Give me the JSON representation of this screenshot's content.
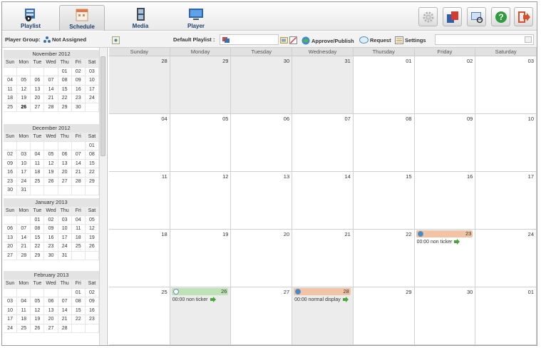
{
  "nav": {
    "playlist": "Playlist",
    "schedule": "Schedule",
    "media": "Media",
    "player": "Player"
  },
  "right_icons": [
    "settings-gear-icon",
    "publish-stack-icon",
    "monitor-search-icon",
    "help-icon",
    "logout-icon"
  ],
  "toolbar": {
    "player_group_label": "Player Group:",
    "player_group_value": "Not Assigned",
    "default_playlist_label": "Default Playlist :",
    "approve_publish": "Approve/Publish",
    "request": "Request",
    "settings": "Settings",
    "search_placeholder": ""
  },
  "mini_calendars": [
    {
      "title": "November 2012",
      "days": [
        "",
        "",
        "",
        "",
        "01",
        "02",
        "03",
        "04",
        "05",
        "06",
        "07",
        "08",
        "09",
        "10",
        "11",
        "12",
        "13",
        "14",
        "15",
        "16",
        "17",
        "18",
        "19",
        "20",
        "21",
        "22",
        "23",
        "24",
        "25",
        "26",
        "27",
        "28",
        "29",
        "30",
        ""
      ],
      "today": "26"
    },
    {
      "title": "December 2012",
      "days": [
        "",
        "",
        "",
        "",
        "",
        "",
        "01",
        "02",
        "03",
        "04",
        "05",
        "06",
        "07",
        "08",
        "09",
        "10",
        "11",
        "12",
        "13",
        "14",
        "15",
        "16",
        "17",
        "18",
        "19",
        "20",
        "21",
        "22",
        "23",
        "24",
        "25",
        "26",
        "27",
        "28",
        "29",
        "30",
        "31",
        "",
        "",
        "",
        "",
        ""
      ]
    },
    {
      "title": "January 2013",
      "days": [
        "",
        "",
        "01",
        "02",
        "03",
        "04",
        "05",
        "06",
        "07",
        "08",
        "09",
        "10",
        "11",
        "12",
        "13",
        "14",
        "15",
        "16",
        "17",
        "18",
        "19",
        "20",
        "21",
        "22",
        "23",
        "24",
        "25",
        "26",
        "27",
        "28",
        "29",
        "30",
        "31",
        "",
        ""
      ]
    },
    {
      "title": "February 2013",
      "days": [
        "",
        "",
        "",
        "",
        "",
        "01",
        "02",
        "03",
        "04",
        "05",
        "06",
        "07",
        "08",
        "09",
        "10",
        "11",
        "12",
        "13",
        "14",
        "15",
        "16",
        "17",
        "18",
        "19",
        "20",
        "21",
        "22",
        "23",
        "24",
        "25",
        "26",
        "27",
        "28",
        "",
        ""
      ]
    }
  ],
  "weekdays_short": [
    "Sun",
    "Mon",
    "Tue",
    "Wed",
    "Thu",
    "Fri",
    "Sat"
  ],
  "weekdays": [
    "Sunday",
    "Monday",
    "Tuesday",
    "Wednesday",
    "Thursday",
    "Friday",
    "Saturday"
  ],
  "calendar_days": [
    "28",
    "29",
    "30",
    "31",
    "01",
    "02",
    "03",
    "04",
    "05",
    "06",
    "07",
    "08",
    "09",
    "10",
    "11",
    "12",
    "13",
    "14",
    "15",
    "16",
    "17",
    "18",
    "19",
    "20",
    "21",
    "22",
    "23",
    "24",
    "25",
    "26",
    "27",
    "28",
    "29",
    "30",
    "01"
  ],
  "events": [
    {
      "cell": 26,
      "color": "orange",
      "text": "00:00 non ticker"
    },
    {
      "cell": 29,
      "color": "green",
      "text": "00:00 non ticker"
    },
    {
      "cell": 31,
      "color": "orange",
      "text": "00:00 normal display"
    }
  ],
  "colors": {
    "event_green": "#bfe2b7",
    "event_orange": "#f3c3a5",
    "nav_text": "#1f3f6c"
  }
}
